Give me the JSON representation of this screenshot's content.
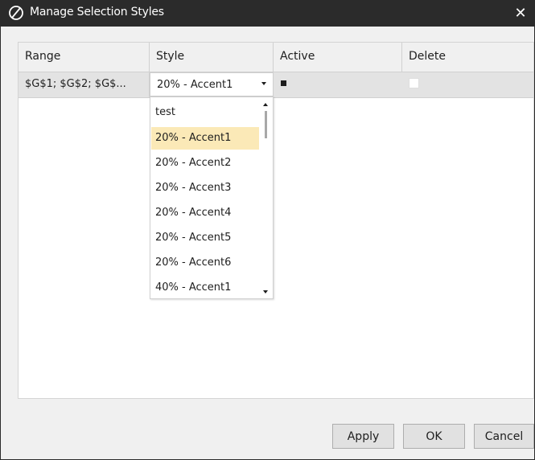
{
  "window": {
    "title": "Manage Selection Styles",
    "close_glyph": "✕",
    "icon": "app-logo-icon"
  },
  "grid": {
    "columns": [
      {
        "label": "Range"
      },
      {
        "label": "Style"
      },
      {
        "label": "Active"
      },
      {
        "label": "Delete"
      }
    ],
    "rows": [
      {
        "range": "$G$1; $G$2; $G$...",
        "style": "20% - Accent1",
        "active": true,
        "delete": false
      }
    ]
  },
  "style_dropdown": {
    "options": [
      "test",
      "20% - Accent1",
      "20% - Accent2",
      "20% - Accent3",
      "20% - Accent4",
      "20% - Accent5",
      "20% - Accent6",
      "40% - Accent1"
    ],
    "highlighted": "20% - Accent1"
  },
  "buttons": {
    "apply": "Apply",
    "ok": "OK",
    "cancel": "Cancel"
  },
  "colors": {
    "titlebar": "#2b2b2b",
    "highlight": "#fbe9b7",
    "row_background": "#e3e3e3"
  }
}
